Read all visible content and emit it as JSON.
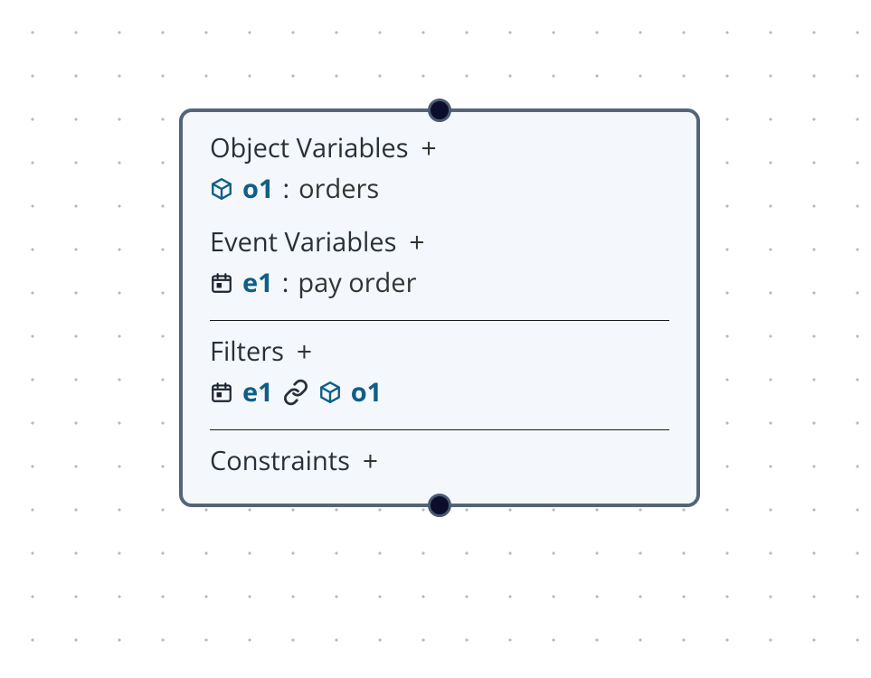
{
  "sections": {
    "objectVariables": {
      "title": "Object Variables",
      "addGlyph": "+",
      "items": [
        {
          "icon": "cube",
          "name": "o1",
          "sep": ":",
          "value": "orders"
        }
      ]
    },
    "eventVariables": {
      "title": "Event Variables",
      "addGlyph": "+",
      "items": [
        {
          "icon": "calendar",
          "name": "e1",
          "sep": ":",
          "value": "pay order"
        }
      ]
    },
    "filters": {
      "title": "Filters",
      "addGlyph": "+",
      "items": [
        {
          "left": {
            "icon": "calendar",
            "name": "e1"
          },
          "linkIcon": "link",
          "right": {
            "icon": "cube",
            "name": "o1"
          }
        }
      ]
    },
    "constraints": {
      "title": "Constraints",
      "addGlyph": "+"
    }
  }
}
